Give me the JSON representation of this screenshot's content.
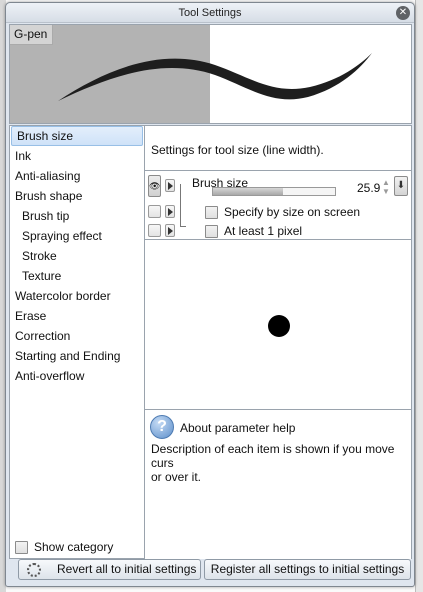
{
  "window": {
    "title": "Tool Settings"
  },
  "preview": {
    "tool_name": "G-pen"
  },
  "categories": [
    {
      "label": "Brush size",
      "selected": true,
      "sub": false
    },
    {
      "label": "Ink",
      "sub": false
    },
    {
      "label": "Anti-aliasing",
      "sub": false
    },
    {
      "label": "Brush shape",
      "sub": false
    },
    {
      "label": "Brush tip",
      "sub": true
    },
    {
      "label": "Spraying effect",
      "sub": true
    },
    {
      "label": "Stroke",
      "sub": true
    },
    {
      "label": "Texture",
      "sub": true
    },
    {
      "label": "Watercolor border",
      "sub": false
    },
    {
      "label": "Erase",
      "sub": false
    },
    {
      "label": "Correction",
      "sub": false
    },
    {
      "label": "Starting and Ending",
      "sub": false
    },
    {
      "label": "Anti-overflow",
      "sub": false
    }
  ],
  "show_category": {
    "label": "Show category",
    "checked": false
  },
  "panel": {
    "description": "Settings for tool size (line width).",
    "brush_size": {
      "label": "Brush size",
      "value": "25.9",
      "fill_fraction": 0.57
    },
    "option_specify": {
      "label": "Specify by size on screen",
      "checked": false
    },
    "option_least": {
      "label": "At least 1 pixel",
      "checked": false
    }
  },
  "help": {
    "title": "About parameter help",
    "text": "Description of each item is shown if you move curs\nor over it."
  },
  "footer": {
    "revert_label": "Revert all to initial settings",
    "register_label": "Register all settings to initial settings"
  }
}
